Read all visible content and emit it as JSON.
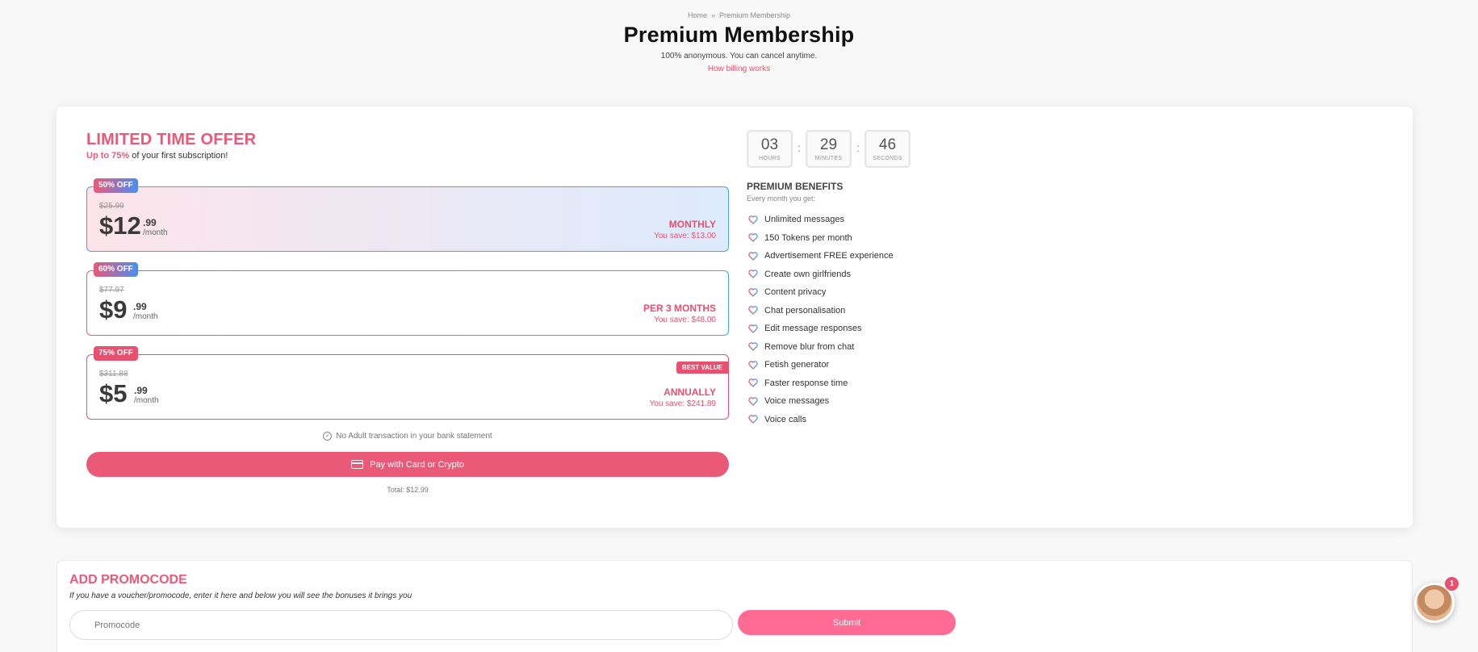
{
  "breadcrumb": {
    "home": "Home",
    "separator": "»",
    "current": "Premium Membership"
  },
  "header": {
    "title": "Premium Membership",
    "subtitle": "100% anonymous. You can cancel anytime.",
    "billing_link": "How billing works"
  },
  "offer": {
    "title": "LIMITED TIME OFFER",
    "sub_highlight": "Up to 75%",
    "sub_rest": " of your first subscription!"
  },
  "plans": [
    {
      "badge": "50% OFF",
      "old_price": "$25.99",
      "price": "$12",
      "cents": ".99",
      "unit": "/month",
      "name": "MONTHLY",
      "save": "You save: $13.00"
    },
    {
      "badge": "60% OFF",
      "old_price": "$77.97",
      "price": "$9",
      "cents": ".99",
      "unit": "/month",
      "name": "PER 3 MONTHS",
      "save": "You save: $48.00"
    },
    {
      "badge": "75% OFF",
      "old_price": "$311.88",
      "price": "$5",
      "cents": ".99",
      "unit": "/month",
      "name": "ANNUALLY",
      "save": "You save: $241.89",
      "tag": "BEST VALUE"
    }
  ],
  "no_adult": "No Adult transaction in your bank statement",
  "pay_button": "Pay with Card or Crypto",
  "total": "Total: $12.99",
  "timer": {
    "hours": "03",
    "hours_label": "HOURS",
    "minutes": "29",
    "minutes_label": "MINUTES",
    "seconds": "46",
    "seconds_label": "SECONDS",
    "separator": ":"
  },
  "benefits": {
    "title": "PREMIUM BENEFITS",
    "subtitle": "Every month you get:",
    "items": [
      "Unlimited messages",
      "150 Tokens per month",
      "Advertisement FREE experience",
      "Create own girlfriends",
      "Content privacy",
      "Chat personalisation",
      "Edit message responses",
      "Remove blur from chat",
      "Fetish generator",
      "Faster response time",
      "Voice messages",
      "Voice calls"
    ]
  },
  "promo": {
    "title": "ADD PROMOCODE",
    "subtitle": "If you have a voucher/promocode, enter it here and below you will see the bonuses it brings you",
    "placeholder": "Promocode",
    "submit": "Submit"
  },
  "chat": {
    "badge_count": "1"
  },
  "colors": {
    "accent": "#ea5a78",
    "blue": "#4aa3f0",
    "submit": "#ff6b93"
  }
}
